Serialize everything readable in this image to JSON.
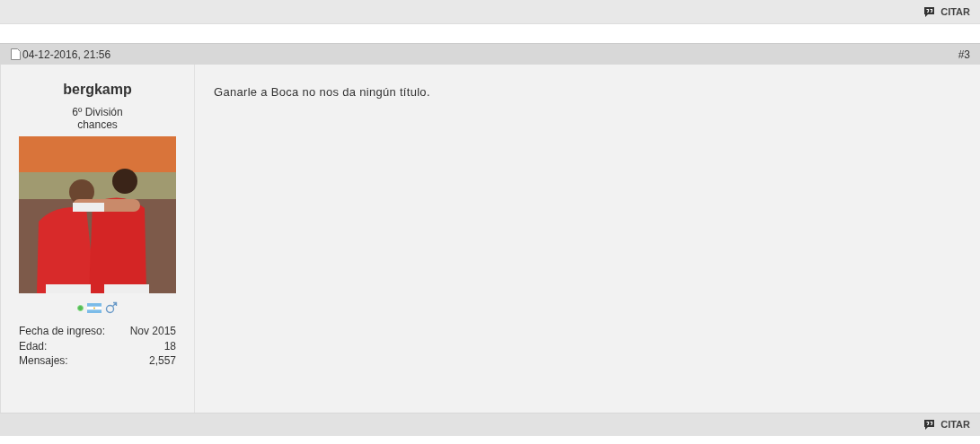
{
  "previous_post_footer": {
    "quote_button": "CITAR"
  },
  "post": {
    "date": "04-12-2016, 21:56",
    "number": "#3",
    "author": {
      "username": "bergkamp",
      "rank": "6º División",
      "title": "chances",
      "online": true,
      "details": [
        {
          "label": "Fecha de ingreso:",
          "value": "Nov 2015"
        },
        {
          "label": "Edad:",
          "value": "18"
        },
        {
          "label": "Mensajes:",
          "value": "2,557"
        }
      ]
    },
    "message": "Ganarle a Boca no nos da ningún título.",
    "quote_button": "CITAR"
  }
}
